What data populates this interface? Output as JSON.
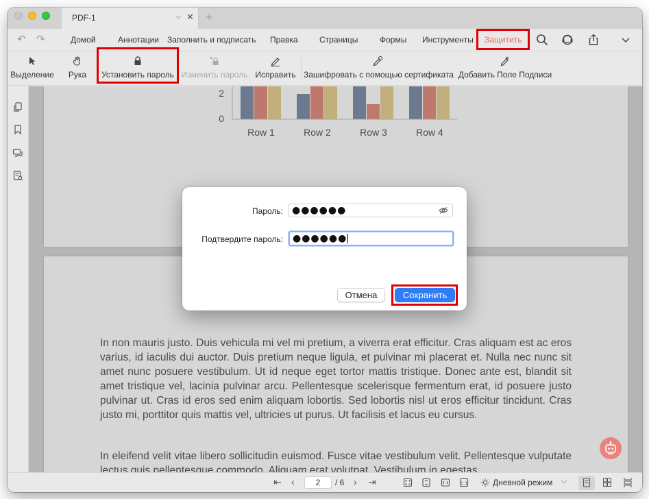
{
  "window": {
    "tab_title": "PDF-1"
  },
  "menu": {
    "items": [
      "Домой",
      "Аннотации",
      "Заполнить и подписать",
      "Правка",
      "Страницы",
      "Формы",
      "Инструменты",
      "Защитить"
    ],
    "active": "Защитить"
  },
  "toolbar": {
    "select": "Выделение",
    "hand": "Рука",
    "set_password": "Установить пароль",
    "change_password": "Изменить пароль",
    "fix": "Исправить",
    "encrypt_cert": "Зашифровать с помощью сертификата",
    "add_signature_field": "Добавить Поле Подписи"
  },
  "chart_data": {
    "type": "bar",
    "categories": [
      "Row 1",
      "Row 2",
      "Row 3",
      "Row 4"
    ],
    "y_ticks": [
      "2",
      "0"
    ],
    "series_colors": [
      "#7b8aa3",
      "#d98a7c",
      "#ddc98e"
    ]
  },
  "document": {
    "paragraph1": "In non mauris justo. Duis vehicula mi vel mi pretium, a viverra erat efficitur. Cras aliquam est ac eros varius, id iaculis dui auctor. Duis pretium neque ligula, et pulvinar mi placerat et. Nulla nec nunc sit amet nunc posuere vestibulum. Ut id neque eget tortor mattis tristique. Donec ante est, blandit sit amet tristique vel, lacinia pulvinar arcu. Pellentesque scelerisque fermentum erat, id posuere justo pulvinar ut. Cras id eros sed enim aliquam lobortis. Sed lobortis nisl ut eros efficitur tincidunt. Cras justo mi, porttitor quis mattis vel, ultricies ut purus. Ut facilisis et lacus eu cursus.",
    "paragraph2": "In eleifend velit vitae libero sollicitudin euismod. Fusce vitae vestibulum velit. Pellentesque vulputate lectus quis pellentesque commodo. Aliquam erat volutpat. Vestibulum in egestas"
  },
  "dialog": {
    "password_label": "Пароль:",
    "password_value": "●●●●●●",
    "confirm_label": "Подтвердите пароль:",
    "confirm_value": "●●●●●●",
    "cancel": "Отмена",
    "save": "Сохранить"
  },
  "statusbar": {
    "current_page": "2",
    "total_pages": "/ 6",
    "mode": "Дневной режим"
  }
}
